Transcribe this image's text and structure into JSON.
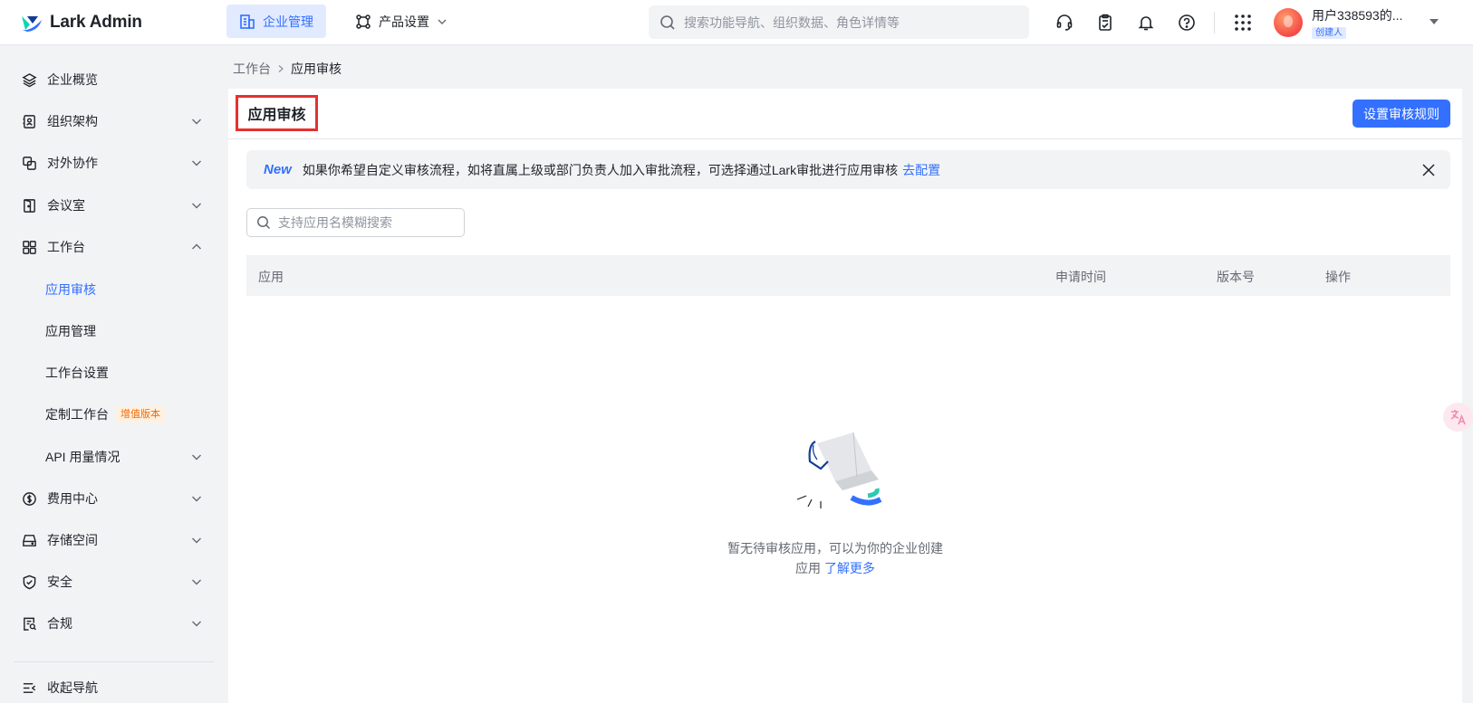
{
  "app": {
    "logo_text": "Lark Admin",
    "brand_colors": {
      "primary": "#3370ff",
      "accent_teal": "#2ec9b5",
      "vip_badge": "#ed6d0c",
      "highlight_border": "#e5312f"
    }
  },
  "topbar": {
    "tabs": [
      {
        "label": "企业管理",
        "icon": "building-icon",
        "active": true
      },
      {
        "label": "产品设置",
        "icon": "product-settings-icon",
        "active": false
      }
    ],
    "search_placeholder": "搜索功能导航、组织数据、角色详情等",
    "icons": [
      "headset-icon",
      "approval-clipboard-icon",
      "bell-icon",
      "help-icon",
      "app-grid-icon"
    ],
    "user": {
      "name": "用户338593的...",
      "role": "创建人"
    }
  },
  "sidebar": {
    "items": [
      {
        "label": "企业概览",
        "icon": "layers-icon",
        "expandable": false
      },
      {
        "label": "组织架构",
        "icon": "org-contacts-icon",
        "expandable": true
      },
      {
        "label": "对外协作",
        "icon": "external-collab-icon",
        "expandable": true
      },
      {
        "label": "会议室",
        "icon": "meeting-room-icon",
        "expandable": true
      },
      {
        "label": "工作台",
        "icon": "workplace-grid-icon",
        "expandable": true,
        "expanded": true
      }
    ],
    "workplace_children": [
      {
        "label": "应用审核",
        "active": true
      },
      {
        "label": "应用管理"
      },
      {
        "label": "工作台设置"
      },
      {
        "label": "定制工作台",
        "badge": "增值版本"
      },
      {
        "label": "API 用量情况",
        "expandable": true
      }
    ],
    "items_after": [
      {
        "label": "费用中心",
        "icon": "billing-icon",
        "expandable": true
      },
      {
        "label": "存储空间",
        "icon": "storage-icon",
        "expandable": true
      },
      {
        "label": "安全",
        "icon": "shield-icon",
        "expandable": true
      },
      {
        "label": "合规",
        "icon": "compliance-icon",
        "expandable": true
      }
    ],
    "collapse_label": "收起导航"
  },
  "breadcrumb": {
    "parent": "工作台",
    "current": "应用审核"
  },
  "main": {
    "title": "应用审核",
    "primary_button": "设置审核规则",
    "notice": {
      "tag": "New",
      "text": "如果你希望自定义审核流程，如将直属上级或部门负责人加入审批流程，可选择通过Lark审批进行应用审核",
      "link": "去配置"
    },
    "search_placeholder": "支持应用名模糊搜索",
    "table": {
      "columns": [
        "应用",
        "申请时间",
        "版本号",
        "操作"
      ],
      "rows": []
    },
    "empty": {
      "line1": "暂无待审核应用，可以为你的企业创建",
      "line2_prefix": "应用",
      "link": "了解更多"
    }
  }
}
